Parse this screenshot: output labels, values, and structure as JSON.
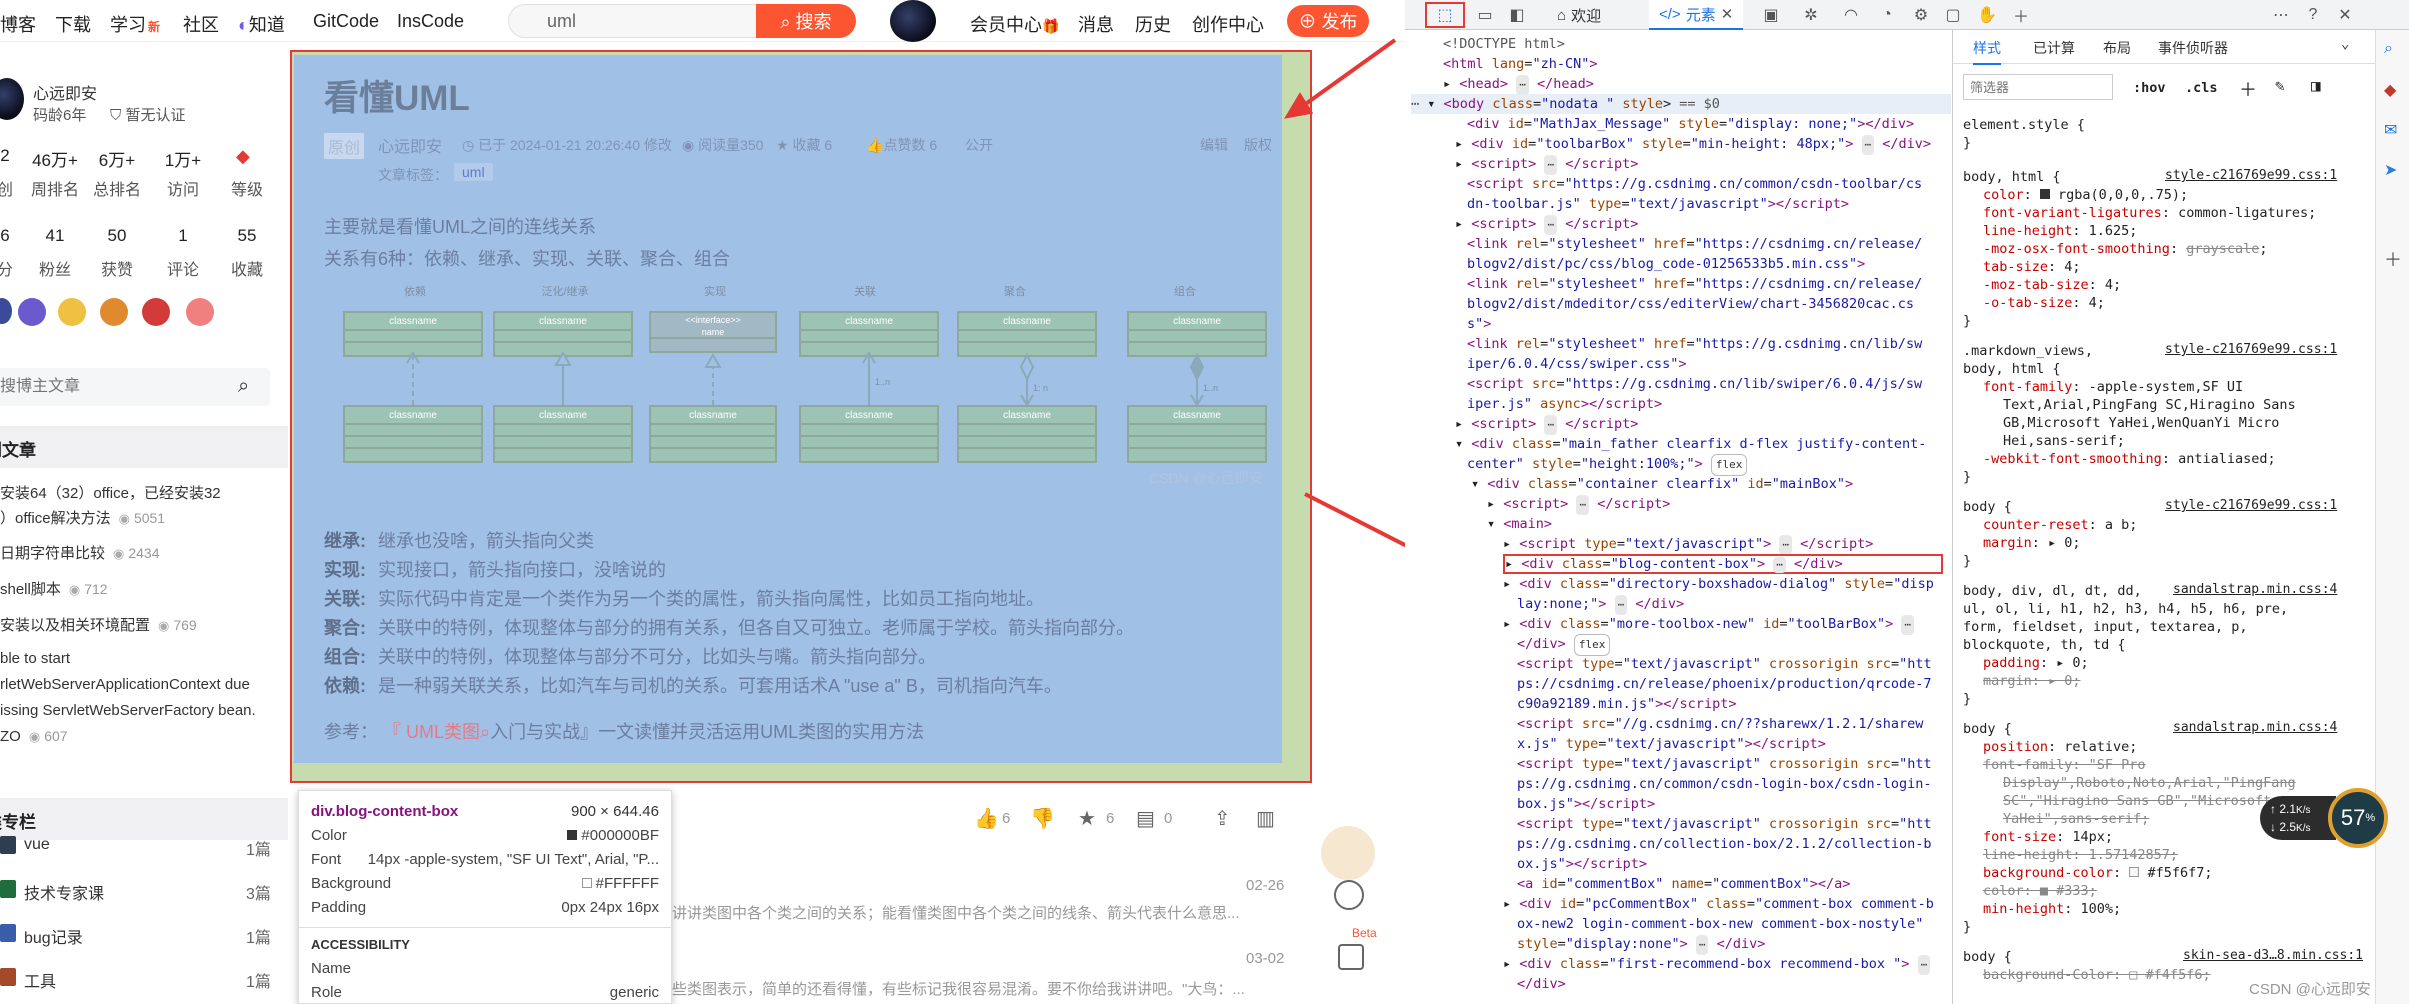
{
  "nav": {
    "items": [
      "博客",
      "下载",
      "学习",
      "社区",
      "知道",
      "GitCode",
      "InsCode"
    ],
    "learn_badge": "新",
    "search_value": "uml",
    "search_button": "搜索",
    "right_items": [
      "会员中心",
      "消息",
      "历史",
      "创作中心"
    ],
    "publish": "发布"
  },
  "sidebar": {
    "author": "心远即安",
    "years": "码龄6年",
    "verified": "暂无认证",
    "stats1": [
      {
        "num": "2",
        "label": "创"
      },
      {
        "num": "46万+",
        "label": "周排名"
      },
      {
        "num": "6万+",
        "label": "总排名"
      },
      {
        "num": "1万+",
        "label": "访问"
      },
      {
        "num": "",
        "label": "等级"
      }
    ],
    "stats2": [
      {
        "num": "6",
        "label": "分"
      },
      {
        "num": "41",
        "label": "粉丝"
      },
      {
        "num": "50",
        "label": "获赞"
      },
      {
        "num": "1",
        "label": "评论"
      },
      {
        "num": "55",
        "label": "收藏"
      }
    ],
    "search_placeholder": "搜博主文章",
    "hot_title": "热门文章",
    "hot": [
      {
        "t": "安装64（32）office，已经安装32",
        "t2": "）office解决方法",
        "v": "5051"
      },
      {
        "t": "日期字符串比较",
        "v": "2434"
      },
      {
        "t": "shell脚本",
        "v": "712"
      },
      {
        "t": "安装以及相关环境配置",
        "v": "769"
      },
      {
        "t": "ble to start",
        "t2": "rletWebServerApplicationContext due",
        "t3": "issing ServletWebServerFactory bean.",
        "t4": "ZO",
        "v": "607"
      }
    ],
    "col_title": "分类专栏",
    "columns": [
      {
        "name": "vue",
        "count": "1篇",
        "color": "#2c3e50"
      },
      {
        "name": "技术专家课",
        "count": "3篇",
        "color": "#1f6d3a"
      },
      {
        "name": "bug记录",
        "count": "1篇",
        "color": "#3a5da8"
      },
      {
        "name": "工具",
        "count": "1篇",
        "color": "#a44a2a"
      }
    ]
  },
  "article": {
    "title": "看懂UML",
    "tag_label": "原创",
    "author": "心远即安",
    "date": "已于 2024-01-21 20:26:40 修改",
    "reads": "阅读量350",
    "fav": "收藏 6",
    "likes": "点赞数 6",
    "public": "公开",
    "edit": "编辑",
    "copyright": "版权",
    "tags_label": "文章标签：",
    "tag": "uml",
    "intro1": "主要就是看懂UML之间的连线关系",
    "intro2": "关系有6种：依赖、继承、实现、关联、聚合、组合",
    "uml_captions": [
      "依赖",
      "泛化/继承",
      "实现",
      "关联",
      "聚合",
      "组合"
    ],
    "uml_class": "classname",
    "uml_interface": "<<interface>>",
    "uml_iname": "name",
    "uml_mult": "1..n",
    "uml_mult2": "1: n",
    "watermark": "CSDN @心远即安",
    "defs": [
      {
        "k": "继承:",
        "v": "继承也没啥，箭头指向父类"
      },
      {
        "k": "实现:",
        "v": "实现接口，箭头指向接口，没啥说的"
      },
      {
        "k": "关联:",
        "v": "实际代码中肯定是一个类作为另一个类的属性，箭头指向属性，比如员工指向地址。"
      },
      {
        "k": "聚合:",
        "v": "关联中的特例，体现整体与部分的拥有关系，但各自又可独立。老师属于学校。箭头指向部分。"
      },
      {
        "k": "组合:",
        "v": "关联中的特例，体现整体与部分不可分，比如头与嘴。箭头指向部分。"
      },
      {
        "k": "依赖:",
        "v": "是一种弱关联关系，比如汽车与司机的关系。可套用话术A \"use a\" B，司机指向汽车。"
      }
    ],
    "ref_label": "参考：",
    "ref_link": "『 UML类图",
    "ref_rest": "入门与实战』一文读懂并灵活运用UML类图的实用方法",
    "bar": {
      "like": "6",
      "fav": "6",
      "comment": "0"
    }
  },
  "tooltip": {
    "selector": "div.blog-content-box",
    "size": "900 × 644.46",
    "rows": [
      {
        "k": "Color",
        "v": "#000000BF"
      },
      {
        "k": "Font",
        "v": "14px -apple-system, \"SF UI Text\", Arial, \"P..."
      },
      {
        "k": "Background",
        "v": "#FFFFFF"
      },
      {
        "k": "Padding",
        "v": "0px 24px 16px"
      }
    ],
    "a11y": "ACCESSIBILITY",
    "name_k": "Name",
    "role_k": "Role",
    "role_v": "generic"
  },
  "recs": [
    {
      "text": "讲讲类图中各个类之间的关系；能看懂类图中各个类之间的线条、箭头代表什么意思...",
      "date": "02-26"
    },
    {
      "text": "些类图表示，简单的还看得懂，有些标记我很容易混淆。要不你给我讲讲吧。\"大鸟：...",
      "date": "03-02"
    }
  ],
  "devtools": {
    "tabs": [
      "欢迎",
      "元素"
    ],
    "style_tabs": [
      "样式",
      "已计算",
      "布局",
      "事件侦听器"
    ],
    "filter_placeholder": "筛选器",
    "hov": ":hov",
    "cls": ".cls",
    "watermark": "CSDN @心远即安",
    "perf_pct": "57",
    "perf_up": "2.1",
    "perf_down": "2.5",
    "perf_unit": "K/s"
  }
}
